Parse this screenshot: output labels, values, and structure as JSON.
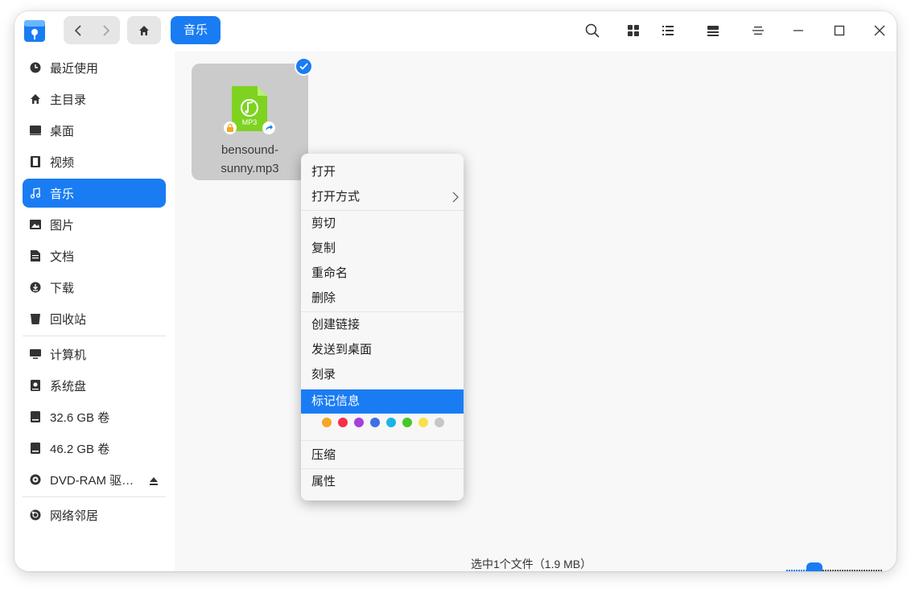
{
  "window": {
    "breadcrumb": "音乐"
  },
  "toolbar": {
    "icons": [
      "search-icon",
      "icon-view-icon",
      "list-view-icon",
      "detail-view-icon",
      "menu-icon",
      "minimize-icon",
      "maximize-icon",
      "close-icon"
    ]
  },
  "sidebar": {
    "items": [
      {
        "label": "最近使用",
        "icon": "recent-icon"
      },
      {
        "label": "主目录",
        "icon": "home-icon"
      },
      {
        "label": "桌面",
        "icon": "desktop-icon"
      },
      {
        "label": "视频",
        "icon": "video-icon"
      },
      {
        "label": "音乐",
        "icon": "music-icon",
        "active": true
      },
      {
        "label": "图片",
        "icon": "picture-icon"
      },
      {
        "label": "文档",
        "icon": "document-icon"
      },
      {
        "label": "下载",
        "icon": "download-icon"
      },
      {
        "label": "回收站",
        "icon": "trash-icon"
      },
      {
        "label": "计算机",
        "icon": "computer-icon"
      },
      {
        "label": "系统盘",
        "icon": "system-disk-icon"
      },
      {
        "label": "32.6 GB 卷",
        "icon": "drive-icon"
      },
      {
        "label": "46.2 GB 卷",
        "icon": "drive-icon"
      },
      {
        "label": "DVD-RAM 驱…",
        "icon": "optical-drive-icon"
      },
      {
        "label": "网络邻居",
        "icon": "network-icon"
      }
    ]
  },
  "file": {
    "name_line1": "bensound-",
    "name_line2": "sunny.mp3",
    "badge": "MP3"
  },
  "context_menu": {
    "items": [
      "打开",
      "打开方式",
      "剪切",
      "复制",
      "重命名",
      "删除",
      "创建链接",
      "发送到桌面",
      "刻录",
      "标记信息",
      "压缩",
      "属性"
    ],
    "highlighted": "标记信息",
    "tag_colors": [
      "#f5a623",
      "#f5304a",
      "#a53fe0",
      "#3f6fe8",
      "#16b6e8",
      "#45c82a",
      "#f7e14a",
      "#c7c7c7"
    ]
  },
  "status": {
    "text": "选中1个文件（1.9 MB）"
  },
  "colors": {
    "accent": "#1a7cf3"
  }
}
